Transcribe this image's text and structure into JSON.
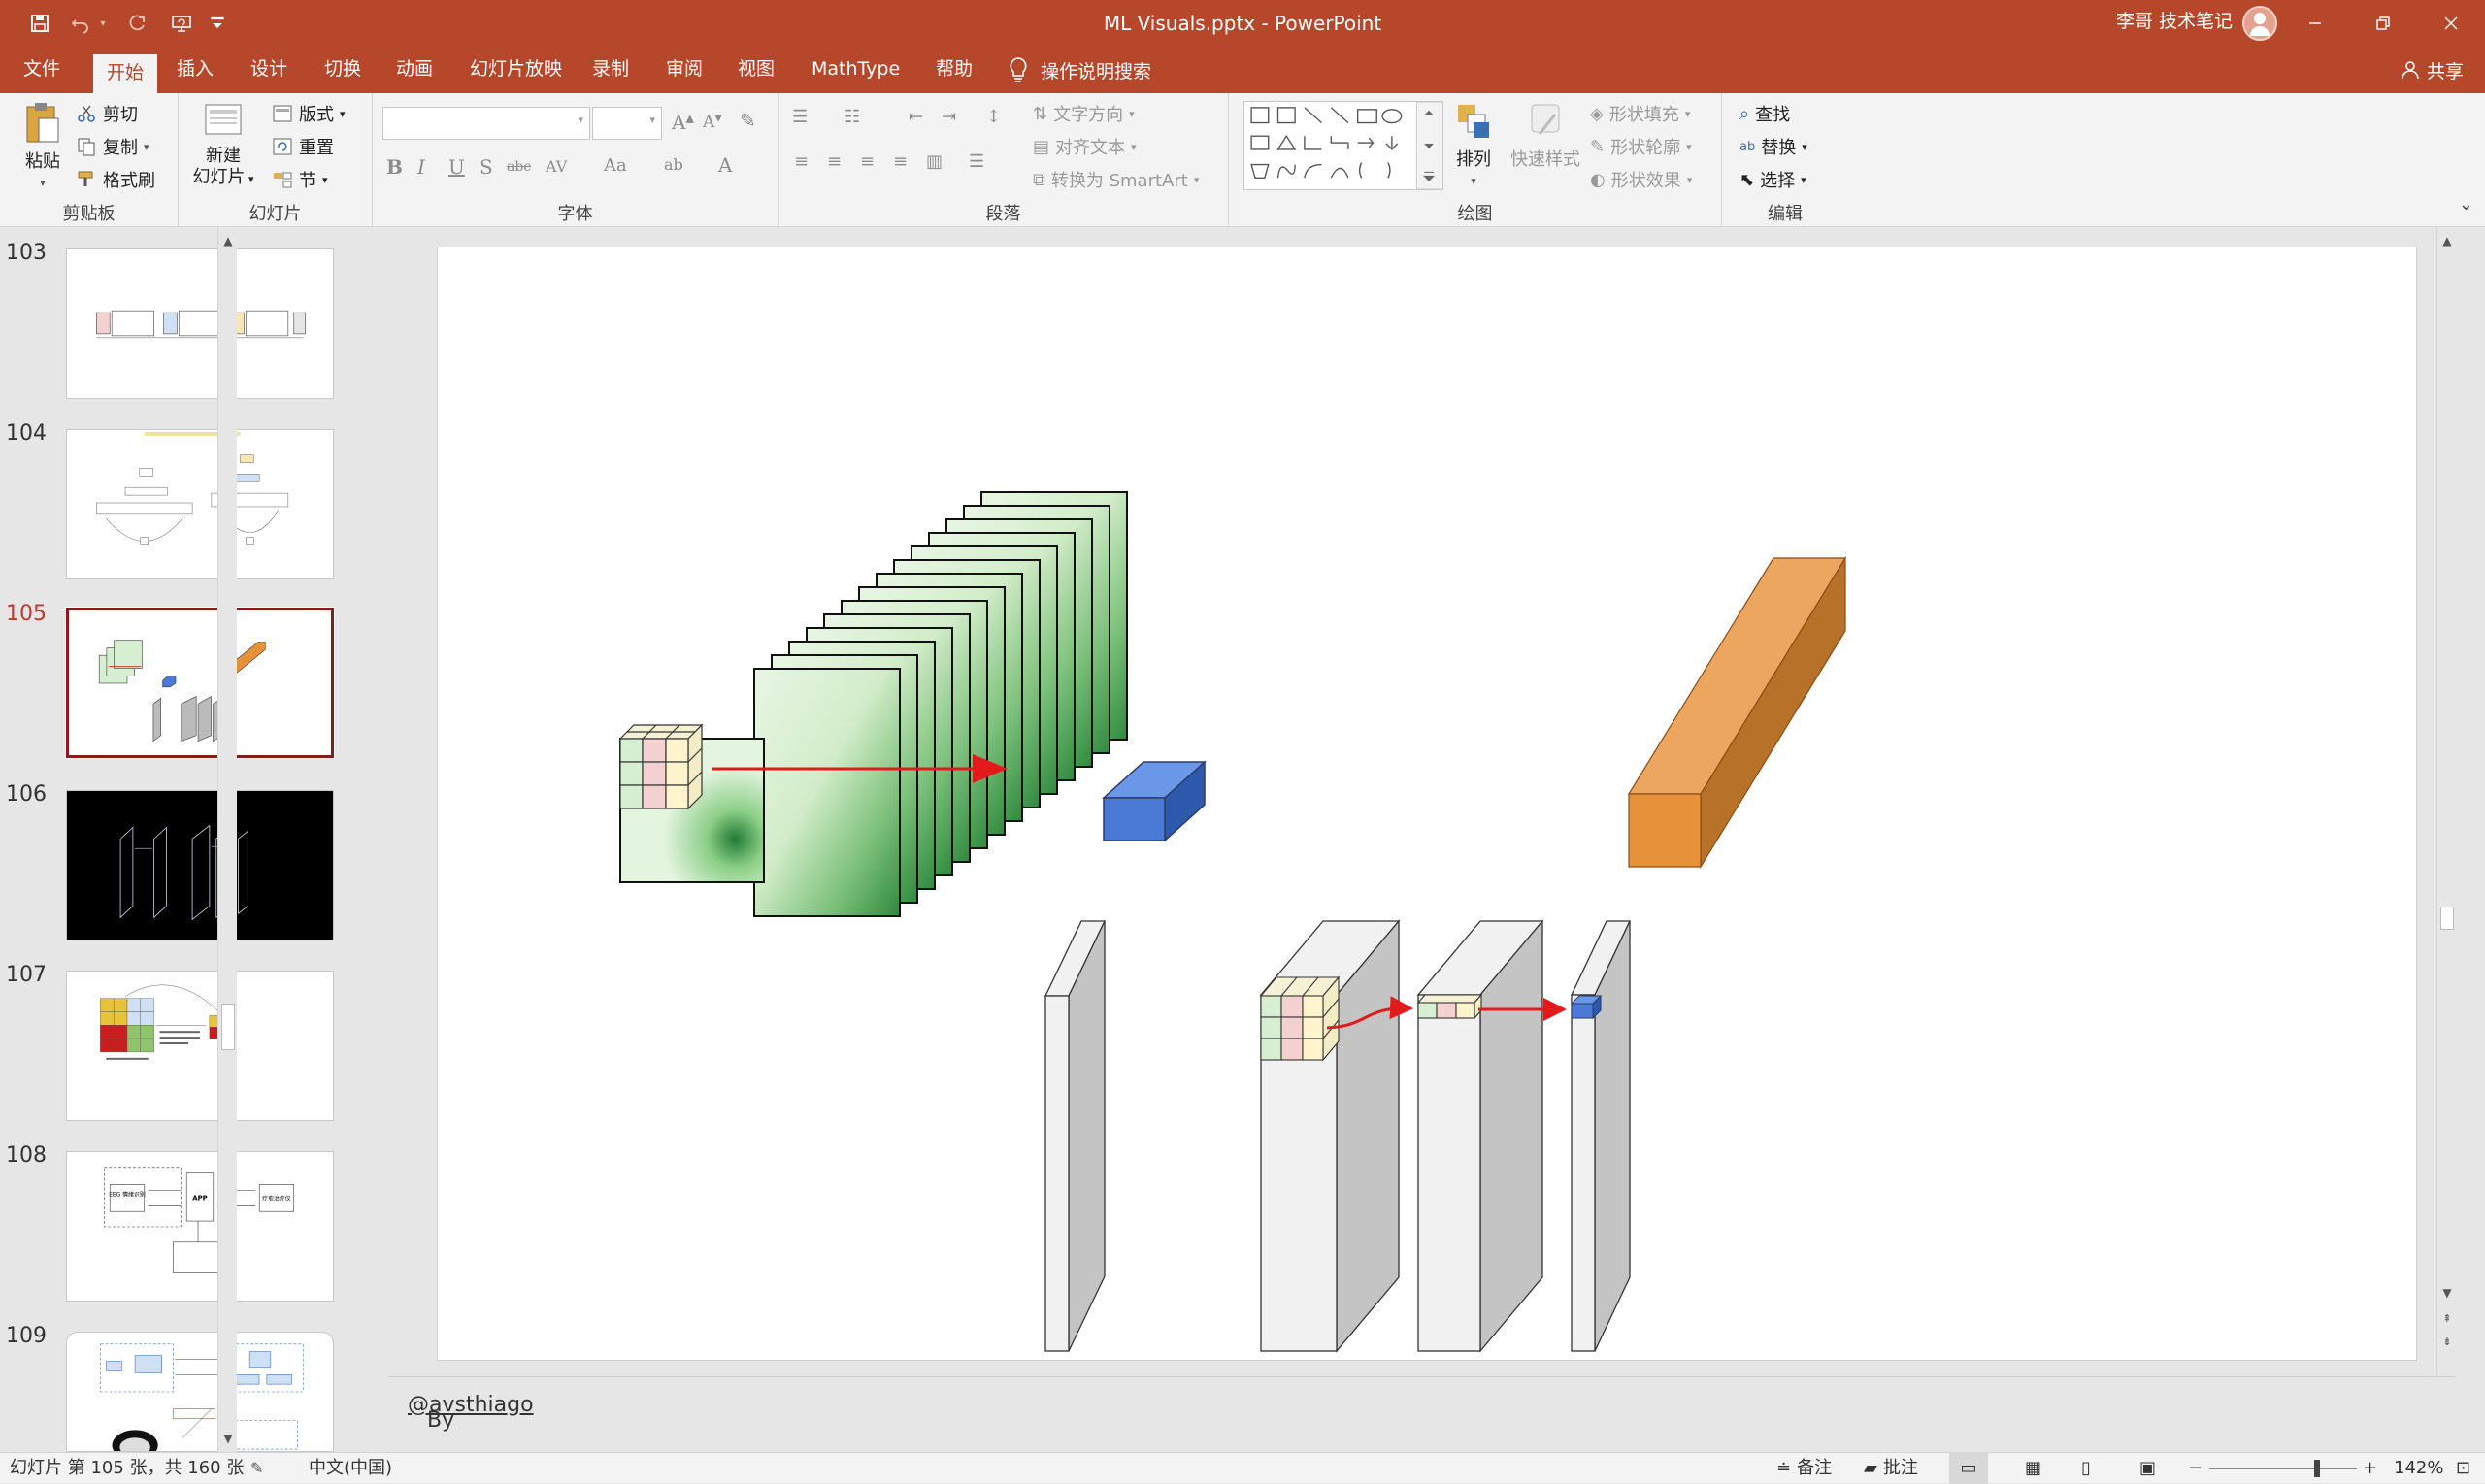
{
  "window": {
    "doc_title": "ML Visuals.pptx  -  PowerPoint",
    "user_name": "李哥 技术笔记"
  },
  "menu": {
    "tabs": [
      "文件",
      "开始",
      "插入",
      "设计",
      "切换",
      "动画",
      "幻灯片放映",
      "录制",
      "审阅",
      "视图",
      "MathType",
      "帮助"
    ],
    "active_tab": "开始",
    "tell_me": "操作说明搜索",
    "share": "共享"
  },
  "ribbon": {
    "clipboard": {
      "label": "剪贴板",
      "paste": "粘贴",
      "cut": "剪切",
      "copy": "复制",
      "format_painter": "格式刷"
    },
    "slides": {
      "label": "幻灯片",
      "new_slide_1": "新建",
      "new_slide_2": "幻灯片",
      "layout": "版式",
      "reset": "重置",
      "section": "节"
    },
    "font": {
      "label": "字体",
      "bold": "B",
      "italic": "I",
      "underline": "U",
      "shadow": "S",
      "strike": "abc",
      "spacing": "AV",
      "case": "Aa",
      "grow": "A",
      "shrink": "A"
    },
    "paragraph": {
      "label": "段落",
      "text_direction": "文字方向",
      "align_text": "对齐文本",
      "smartart": "转换为 SmartArt"
    },
    "drawing": {
      "label": "绘图",
      "arrange": "排列",
      "quick_styles": "快速样式",
      "shape_fill": "形状填充",
      "shape_outline": "形状轮廓",
      "shape_effects": "形状效果"
    },
    "editing": {
      "label": "编辑",
      "find": "查找",
      "replace": "替换",
      "select": "选择"
    }
  },
  "thumbnails": [
    {
      "number": "103",
      "active": false
    },
    {
      "number": "104",
      "active": false
    },
    {
      "number": "105",
      "active": true
    },
    {
      "number": "106",
      "active": false
    },
    {
      "number": "107",
      "active": false
    },
    {
      "number": "108",
      "active": false
    },
    {
      "number": "109",
      "active": false
    }
  ],
  "thumb_text": {
    "t108_eeg": "EEG\n情绪识别",
    "t108_app": "APP",
    "t108_right": "疗愈治疗仪"
  },
  "notes": {
    "prefix": "By ",
    "handle": "@avsthiago"
  },
  "status": {
    "slide_info": "幻灯片 第 105 张，共 160 张",
    "language": "中文(中国)",
    "notes_btn": "备注",
    "comments_btn": "批注",
    "zoom": "142%"
  },
  "colors": {
    "accent": "#b7472a",
    "active_thumb": "#8b1a1a",
    "cube_blue": "#4a7ad6",
    "bar_orange": "#e5923a",
    "arrow_red": "#e31a1c",
    "feature_green": "#d6efd0"
  }
}
